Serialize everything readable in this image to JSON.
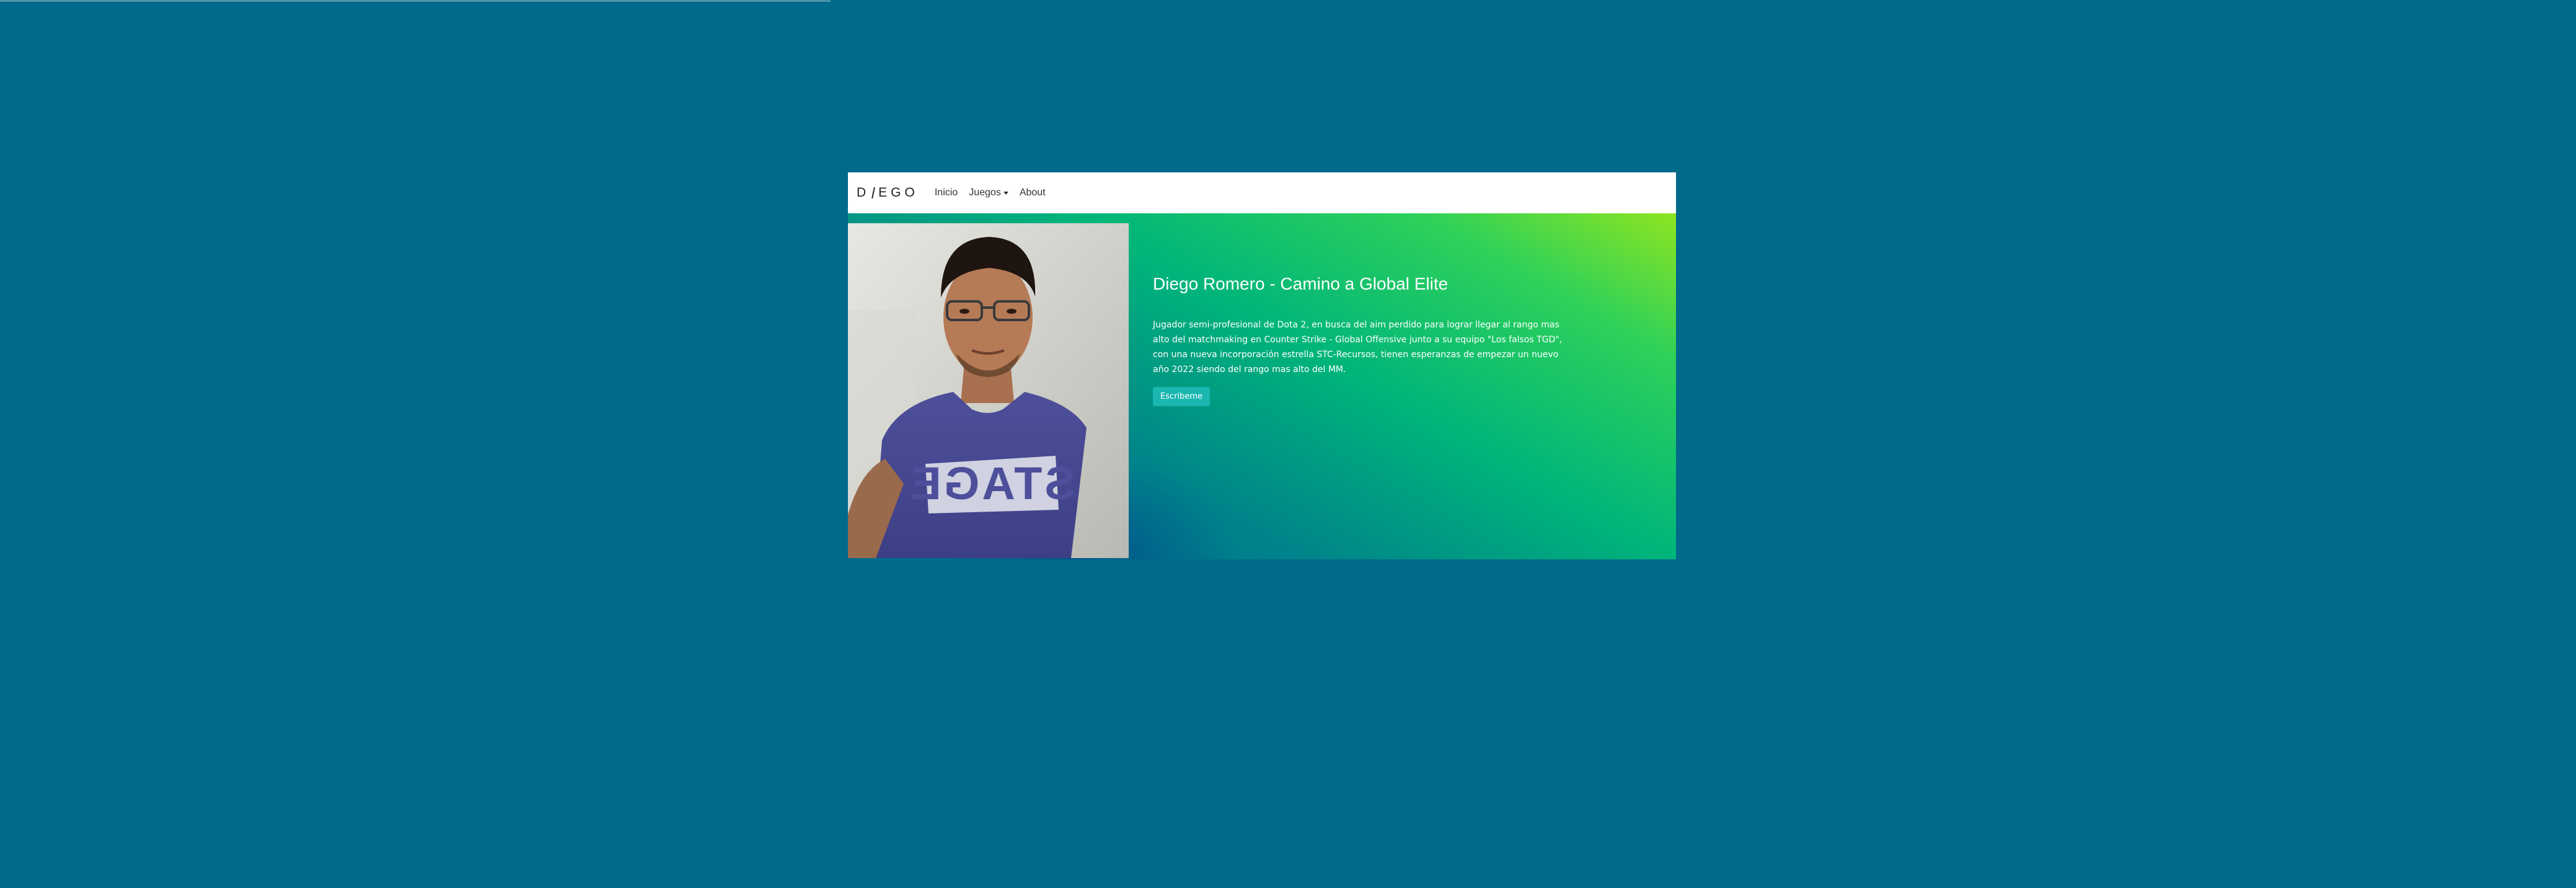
{
  "navbar": {
    "brand": "D",
    "brand_rest": "EGO",
    "links": [
      "Inicio",
      "Juegos",
      "About"
    ]
  },
  "hero": {
    "title": "Diego Romero - Camino a Global Elite",
    "text": "Jugador semi-profesional de Dota 2, en busca del aim perdido para lograr llegar al rango mas alto del matchmaking en Counter Strike - Global Offensive junto a su equipo \"Los falsos TGD\", con una nueva incorporación estrella STC-Recursos, tienen esperanzas de empezar un nuevo año 2022 siendo del rango mas alto del MM.",
    "button": "Escribeme"
  },
  "photo": {
    "shirt_text": "STAGE"
  },
  "colors": {
    "page_bg": "#006a8a",
    "button_bg": "#1ab7b0",
    "gradient_light": "#8ee520",
    "gradient_dark": "#006e8c"
  },
  "icons": [
    "caret-down-icon"
  ]
}
